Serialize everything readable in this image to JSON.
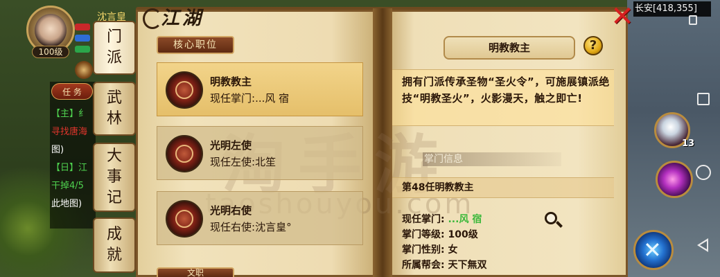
{
  "hud": {
    "player_name": "沈言皇",
    "level": "100级"
  },
  "quests": {
    "tab_label": "任 务",
    "lines": [
      {
        "text": "【主】纟",
        "color": "#4fd24f"
      },
      {
        "text": "寻找唐海",
        "color": "#e0352c"
      },
      {
        "text": "图)",
        "color": "#ffffff"
      },
      {
        "text": "【日】江",
        "color": "#4fd24f"
      },
      {
        "text": "干掉4/5",
        "color": "#4fd24f"
      },
      {
        "text": "此地图)",
        "color": "#ffffff"
      }
    ]
  },
  "side_tabs": [
    {
      "label": "门派",
      "active": true
    },
    {
      "label": "武林",
      "active": false
    },
    {
      "label": "大事记",
      "active": false
    },
    {
      "label": "成就",
      "active": false
    }
  ],
  "book": {
    "title": "江湖",
    "core_tab": "核心职位",
    "more_tab": "文职",
    "positions": [
      {
        "name": "明教教主",
        "holder_label": "现任掌门:",
        "holder": "...风 宿",
        "selected": true
      },
      {
        "name": "光明左使",
        "holder_label": "现任左使:",
        "holder": "北笙",
        "selected": false
      },
      {
        "name": "光明右使",
        "holder_label": "现任右使:",
        "holder": "沈言皇°",
        "selected": false
      }
    ],
    "detail": {
      "title": "明教教主",
      "description": "拥有门派传承圣物“圣火令”，可施展镇派绝技“明教圣火”，火影漫天，触之即亡!",
      "info_heading": "掌门信息",
      "generation": "第48任明教教主",
      "rows": [
        {
          "label": "现任掌门: ",
          "value": "...风 宿",
          "color": "green"
        },
        {
          "label": "掌门等级: ",
          "value": "100级",
          "color": "normal"
        },
        {
          "label": "掌门性别: ",
          "value": "女",
          "color": "normal"
        },
        {
          "label": "所属帮会: ",
          "value": "天下無双",
          "color": "normal"
        }
      ]
    }
  },
  "watermark": {
    "logo": "淘手游",
    "url": "taoshouyou.com"
  },
  "location": "长安[418,355]",
  "potion_count": "13",
  "icons": {
    "close": "close-x-icon",
    "help": "question-icon",
    "search": "magnifier-icon",
    "nav": [
      "square-icon",
      "circle-icon",
      "back-triangle-icon"
    ]
  },
  "colors": {
    "close_red": "#d62020",
    "holder_green": "#3ab83a",
    "selected_card": "#f2d48a"
  }
}
